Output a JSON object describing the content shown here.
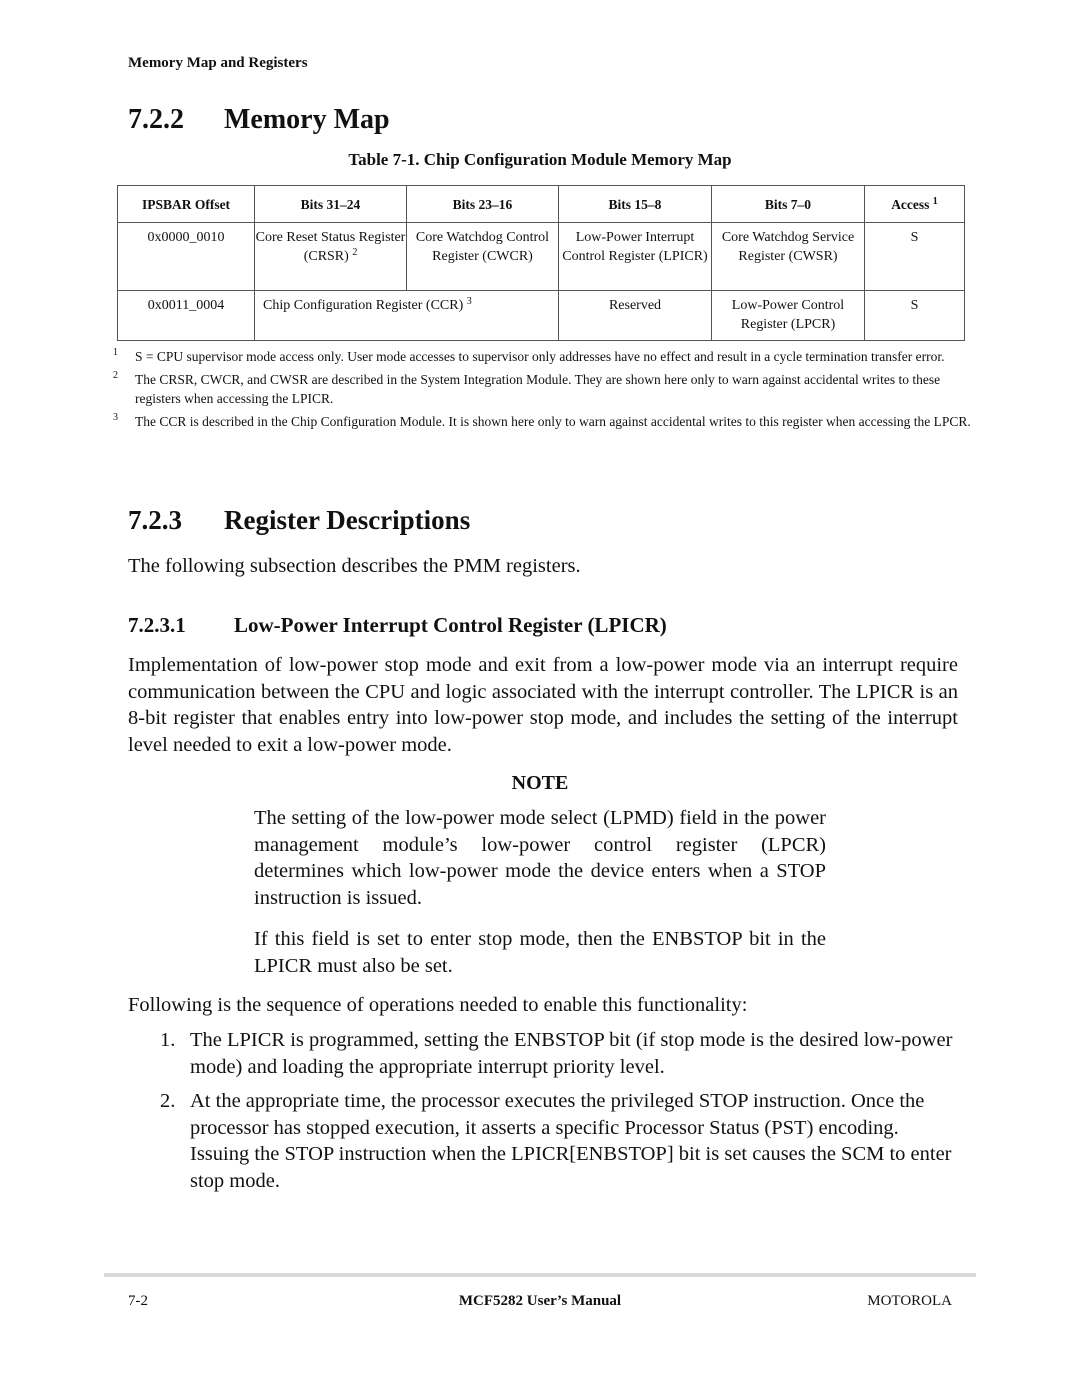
{
  "running_head": "Memory Map and Registers",
  "section_722": {
    "number": "7.2.2",
    "title": "Memory Map"
  },
  "table": {
    "caption": "Table 7-1. Chip Configuration Module Memory Map",
    "headers": [
      "IPSBAR Offset",
      "Bits 31–24",
      "Bits 23–16",
      "Bits 15–8",
      "Bits 7–0",
      "Access"
    ],
    "access_footnote_mark": "1",
    "rows": [
      {
        "offset": "0x0000_0010",
        "bits_31_24": "Core Reset Status Register (CRSR)",
        "bits_31_24_mark": "2",
        "bits_23_16": "Core Watchdog Control Register (CWCR)",
        "bits_15_8": "Low-Power Interrupt Control Register (LPICR)",
        "bits_7_0": "Core Watchdog Service Register (CWSR)",
        "access": "S"
      },
      {
        "offset": "0x0011_0004",
        "bits_31_16": "Chip Configuration Register (CCR)",
        "bits_31_16_mark": "3",
        "bits_15_8": "Reserved",
        "bits_7_0": "Low-Power Control Register (LPCR)",
        "access": "S"
      }
    ]
  },
  "footnotes": [
    {
      "mark": "1",
      "text": "S = CPU supervisor mode access only. User mode accesses to supervisor only addresses have no effect and result in a cycle termination transfer error."
    },
    {
      "mark": "2",
      "text": "The CRSR, CWCR, and CWSR are described in the System Integration Module. They are shown here only to warn against accidental writes to these registers when accessing the LPICR."
    },
    {
      "mark": "3",
      "text": "The CCR is described in the Chip Configuration Module. It is shown here only to warn against accidental writes to this register when accessing the LPCR."
    }
  ],
  "section_723": {
    "number": "7.2.3",
    "title": "Register Descriptions",
    "intro": "The following subsection describes the PMM registers."
  },
  "section_7231": {
    "number": "7.2.3.1",
    "title": "Low-Power Interrupt Control Register (LPICR)",
    "paragraph": "Implementation of low-power stop mode and exit from a low-power mode via an interrupt require communication between the CPU and logic associated with the interrupt controller. The LPICR is an 8-bit register that enables entry into low-power stop mode, and includes the setting of the interrupt level needed to exit a low-power mode."
  },
  "note": {
    "title": "NOTE",
    "p1": "The setting of the low-power mode select (LPMD) field in the power management module’s low-power control register (LPCR) determines which low-power mode the device enters when a STOP instruction is issued.",
    "p2": "If this field is set to enter stop mode, then the ENBSTOP bit in the LPICR must also be set."
  },
  "sequence_intro": "Following is the sequence of operations needed to enable this functionality:",
  "sequence": [
    {
      "n": "1.",
      "text": "The LPICR is programmed, setting the ENBSTOP bit (if stop mode is the desired low-power mode) and loading the appropriate interrupt priority level."
    },
    {
      "n": "2.",
      "text": "At the appropriate time, the processor executes the privileged STOP instruction. Once the processor has stopped execution, it asserts a specific Processor Status (PST) encoding. Issuing the STOP instruction when the LPICR[ENBSTOP] bit is set causes the SCM to enter stop mode."
    }
  ],
  "footer": {
    "page": "7-2",
    "title": "MCF5282 User’s Manual",
    "brand": "MOTOROLA"
  }
}
